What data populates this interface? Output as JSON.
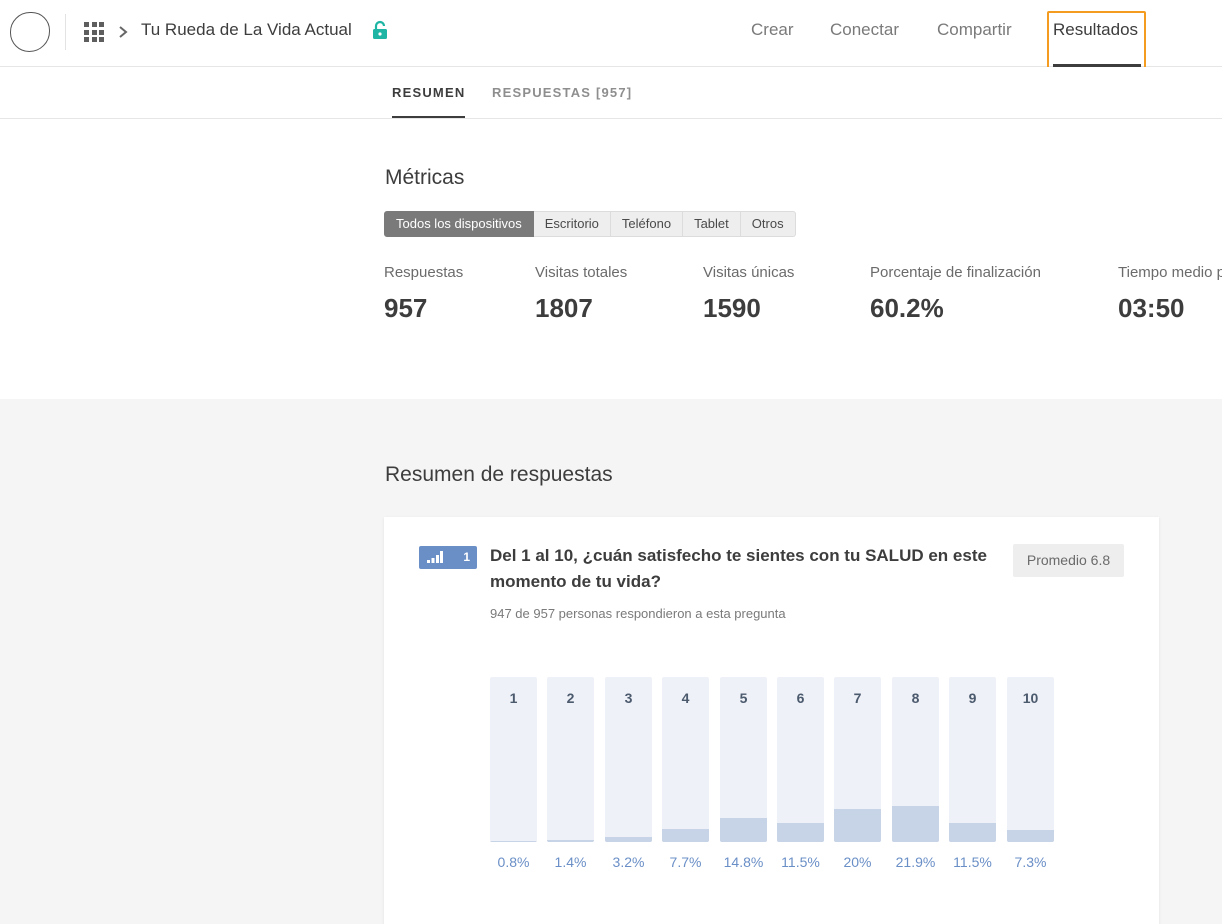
{
  "header": {
    "doc_title": "Tu Rueda de La Vida Actual",
    "nav": [
      {
        "label": "Crear"
      },
      {
        "label": "Conectar"
      },
      {
        "label": "Compartir"
      },
      {
        "label": "Resultados",
        "active": true
      }
    ],
    "icons": [
      "logo",
      "apps-grid-icon",
      "chevron-right-icon",
      "lock-icon"
    ],
    "lock_color": "#1fb5a4",
    "focus_color": "#f39c1f"
  },
  "subtabs": [
    {
      "label": "RESUMEN",
      "active": true
    },
    {
      "label": "RESPUESTAS [957]"
    }
  ],
  "metrics": {
    "title": "Métricas",
    "filters": [
      {
        "label": "Todos los dispositivos",
        "active": true
      },
      {
        "label": "Escritorio"
      },
      {
        "label": "Teléfono"
      },
      {
        "label": "Tablet"
      },
      {
        "label": "Otros"
      }
    ],
    "items": [
      {
        "label": "Respuestas",
        "value": "957"
      },
      {
        "label": "Visitas totales",
        "value": "1807"
      },
      {
        "label": "Visitas únicas",
        "value": "1590"
      },
      {
        "label": "Porcentaje de finalización",
        "value": "60.2%"
      },
      {
        "label": "Tiempo medio p",
        "value": "03:50"
      }
    ]
  },
  "summary": {
    "title": "Resumen de respuestas",
    "question": {
      "number": "1",
      "icon": "opinion-scale-icon",
      "title": "Del 1 al 10, ¿cuán satisfecho te sientes con tu SALUD en este momento de tu vida?",
      "subtitle": "947 de 957 personas respondieron a esta pregunta",
      "average": "Promedio 6.8"
    }
  },
  "chart_data": {
    "type": "bar",
    "categories": [
      "1",
      "2",
      "3",
      "4",
      "5",
      "6",
      "7",
      "8",
      "9",
      "10"
    ],
    "values": [
      0.8,
      1.4,
      3.2,
      7.7,
      14.8,
      11.5,
      20,
      21.9,
      11.5,
      7.3
    ],
    "labels": [
      "0.8%",
      "1.4%",
      "3.2%",
      "7.7%",
      "14.8%",
      "11.5%",
      "20%",
      "21.9%",
      "11.5%",
      "7.3%"
    ],
    "ylim": [
      0,
      100
    ],
    "bar_color": "#c7d3e6",
    "track_color": "#eef1f7",
    "label_color": "#6a8fc7"
  }
}
